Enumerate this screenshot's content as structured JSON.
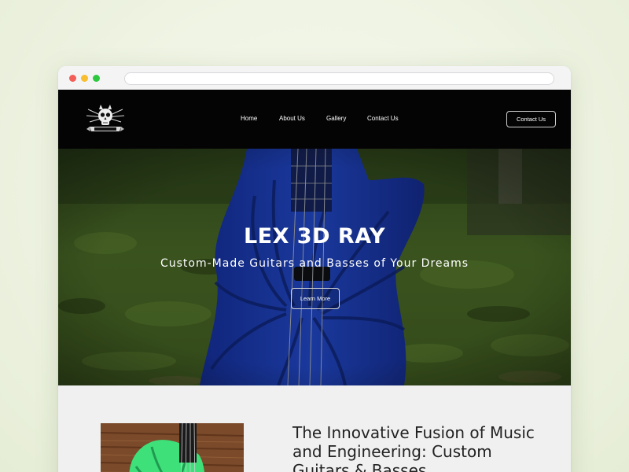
{
  "site": {
    "logo_name": "lex-3d-ray-logo",
    "nav": [
      {
        "label": "Home"
      },
      {
        "label": "About Us"
      },
      {
        "label": "Gallery"
      },
      {
        "label": "Contact Us"
      }
    ],
    "header_button": "Contact Us"
  },
  "hero": {
    "title": "LEX 3D RAY",
    "subtitle": "Custom-Made Guitars and Basses of Your Dreams",
    "cta": "Learn More"
  },
  "content": {
    "heading": "The Innovative Fusion of Music and Engineering: Custom Guitars & Basses"
  },
  "colors": {
    "header_bg": "#040404",
    "guitar_blue": "#1c3fd6",
    "grass_green": "#4a6b24",
    "content_guitar_green": "#3ee07a",
    "content_bg": "#f0f0f0"
  }
}
